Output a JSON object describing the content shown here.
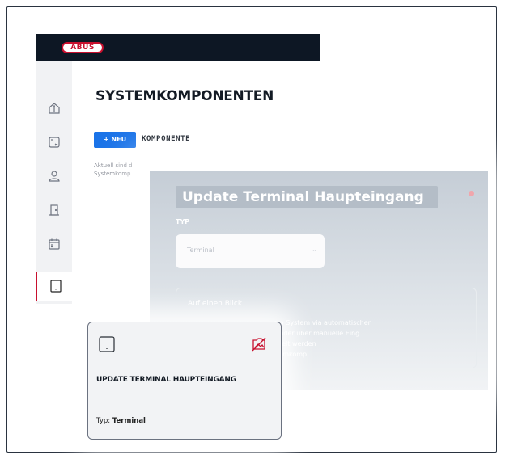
{
  "app": {
    "logo": "ABUS"
  },
  "sidebar": {
    "items": [
      {
        "name": "info",
        "icon": "info-icon"
      },
      {
        "name": "calculator",
        "icon": "calculator-icon"
      },
      {
        "name": "users",
        "icon": "user-icon"
      },
      {
        "name": "doors",
        "icon": "door-icon"
      },
      {
        "name": "calendar",
        "icon": "calendar-icon"
      },
      {
        "name": "components",
        "icon": "tablet-icon",
        "active": true
      }
    ]
  },
  "page": {
    "title": "SYSTEMKOMPONENTEN",
    "new_button": "+ NEU",
    "new_label": "KOMPONENTE",
    "description_line1": "Aktuell sind d",
    "description_line2": "Systemkomp"
  },
  "modal": {
    "title": "Update Terminal Haupteingang",
    "type_label": "TYP",
    "type_value": "Terminal",
    "info_header": "Auf einen Blick",
    "info_line1": "em System via automatischer",
    "info_line2": "e oder über manuelle Eing",
    "info_line3": "ppelt werden",
    "info_line4": "ttemkomp"
  },
  "card": {
    "title": "UPDATE TERMINAL HAUPTEINGANG",
    "type_prefix": "Typ:",
    "type_value": "Terminal",
    "icon": "tablet-icon",
    "action_icon": "no-image-icon"
  },
  "colors": {
    "brand_red": "#c8102e",
    "navy": "#0d1724",
    "accent_blue": "#1a73e8"
  }
}
